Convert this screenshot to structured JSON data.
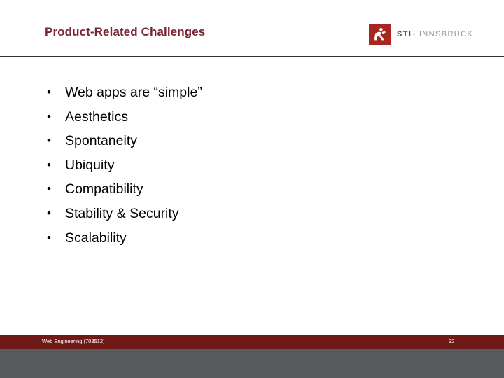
{
  "slide": {
    "title": "Product-Related Challenges",
    "title_color": "#7B2433",
    "background_color": "#FFFFFF",
    "rule_color": "#333437"
  },
  "logo": {
    "mark_name": "sti-innsbruck-figure-icon",
    "mark_color": "#A92620",
    "wordmark_primary": "STI",
    "wordmark_separator_and_secondary": "- INNSBRUCK",
    "primary_color": "#4D4D4F",
    "secondary_color": "#8D8F91"
  },
  "content": {
    "bullet_marker": "•",
    "bullets": [
      {
        "text": "Web apps are “simple”"
      },
      {
        "text": "Aesthetics"
      },
      {
        "text": "Spontaneity"
      },
      {
        "text": "Ubiquity"
      },
      {
        "text": "Compatibility"
      },
      {
        "text": "Stability & Security"
      },
      {
        "text": "Scalability"
      }
    ]
  },
  "footer": {
    "course": "Web Engineering (703512)",
    "page_number": "32",
    "bar_color": "#6F1A17",
    "gray_bar_color": "#57595B",
    "text_color": "#FFFFFF"
  }
}
